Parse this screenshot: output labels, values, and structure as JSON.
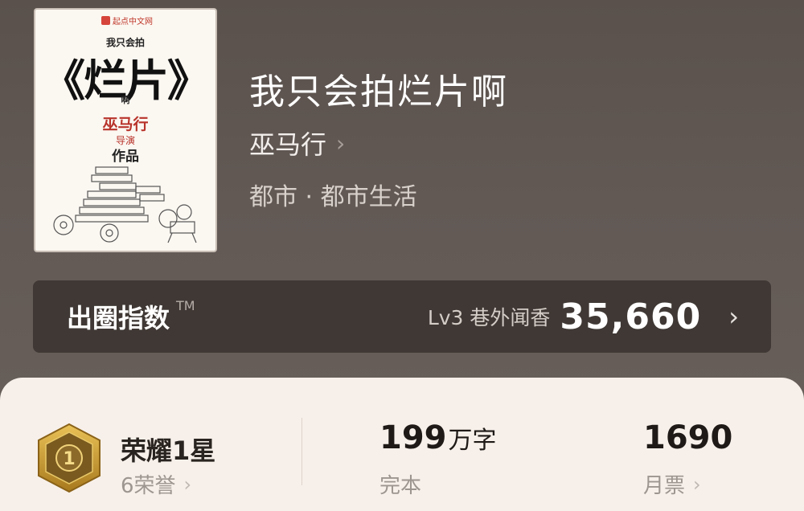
{
  "book": {
    "cover": {
      "publisher": "起点中文网",
      "line1": "我只会拍",
      "line2": "《烂片》",
      "line3": "啊",
      "author": "巫马行",
      "role": "导演",
      "works": "作品"
    },
    "title": "我只会拍烂片啊",
    "author": "巫马行",
    "genre": "都市 · 都市生活"
  },
  "index": {
    "label": "出圈指数",
    "tm": "TM",
    "level": "Lv3 巷外闻香",
    "score": "35,660"
  },
  "stats": {
    "honor": {
      "name": "荣耀1星",
      "sub": "6荣誉",
      "badge_number": "1"
    },
    "words": {
      "num": "199",
      "unit": "万字",
      "sub": "完本"
    },
    "tickets": {
      "num": "1690",
      "sub": "月票"
    }
  },
  "icons": {
    "chevron": "›"
  },
  "colors": {
    "background": "#5f5652",
    "index_bar": "#3f3834",
    "panel": "#f7f0ea",
    "badge_gold": "#c99a2e",
    "cover_red": "#b8342b"
  }
}
